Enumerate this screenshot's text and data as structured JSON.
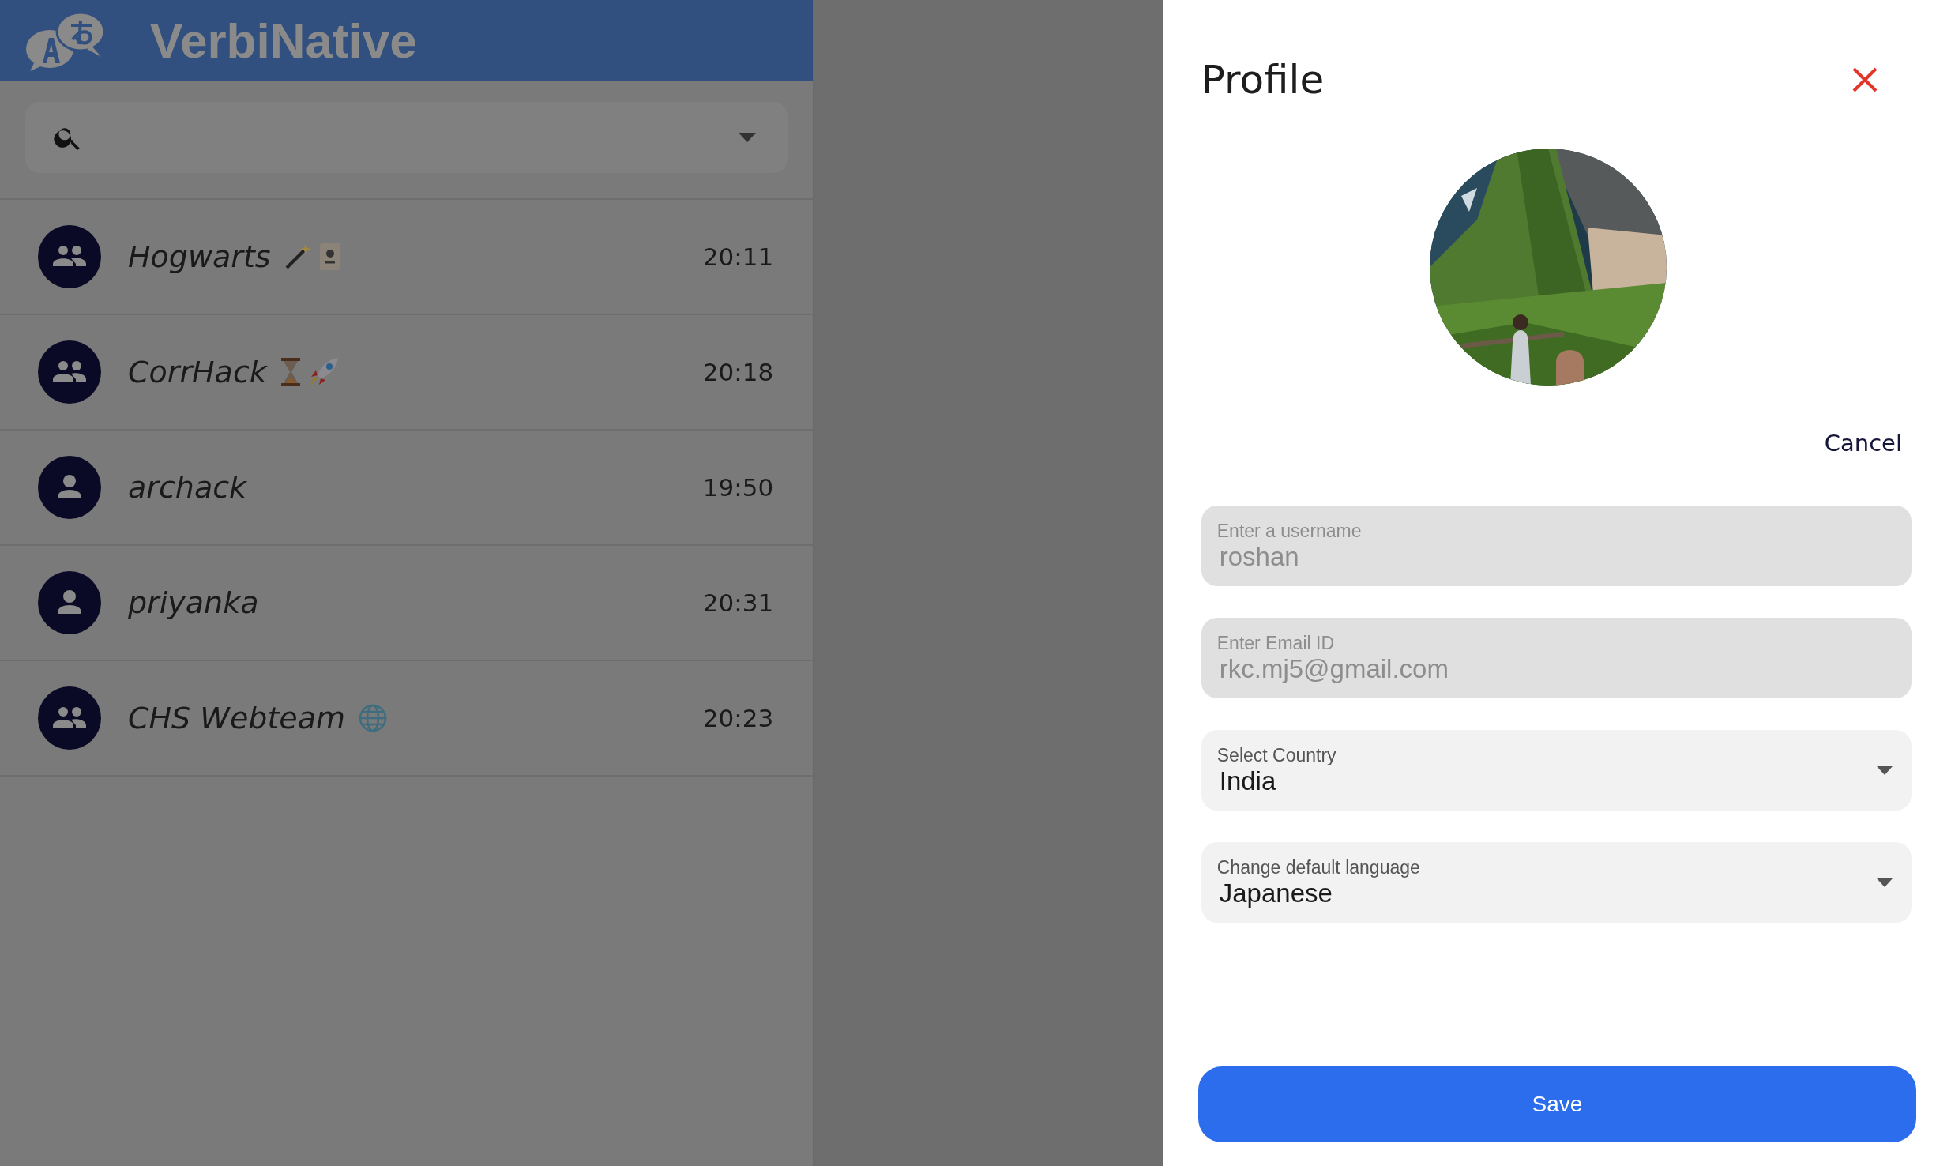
{
  "app": {
    "title": "VerbiNative"
  },
  "chats": [
    {
      "name": "Hogwarts",
      "time": "20:11",
      "kind": "group",
      "emoji": [
        {
          "kind": "wand"
        },
        {
          "kind": "card"
        }
      ]
    },
    {
      "name": "CorrHack",
      "time": "20:18",
      "kind": "group",
      "emoji": [
        {
          "kind": "hourglass"
        },
        {
          "kind": "rocket"
        }
      ]
    },
    {
      "name": "archack",
      "time": "19:50",
      "kind": "person"
    },
    {
      "name": "priyanka",
      "time": "20:31",
      "kind": "person"
    },
    {
      "name": "CHS Webteam",
      "time": "20:23",
      "kind": "group",
      "emoji": [
        {
          "kind": "globe"
        }
      ]
    }
  ],
  "profile": {
    "title": "Profile",
    "cancel": "Cancel",
    "fields": [
      {
        "kind": "text",
        "label": "Enter a username",
        "value": "roshan",
        "disabled": true
      },
      {
        "kind": "text",
        "label": "Enter Email ID",
        "value": "rkc.mj5@gmail.com",
        "disabled": true
      },
      {
        "kind": "select",
        "label": "Select Country",
        "value": "India",
        "disabled": false
      },
      {
        "kind": "select",
        "label": "Change default language",
        "value": "Japanese",
        "disabled": false
      }
    ],
    "save": "Save"
  }
}
